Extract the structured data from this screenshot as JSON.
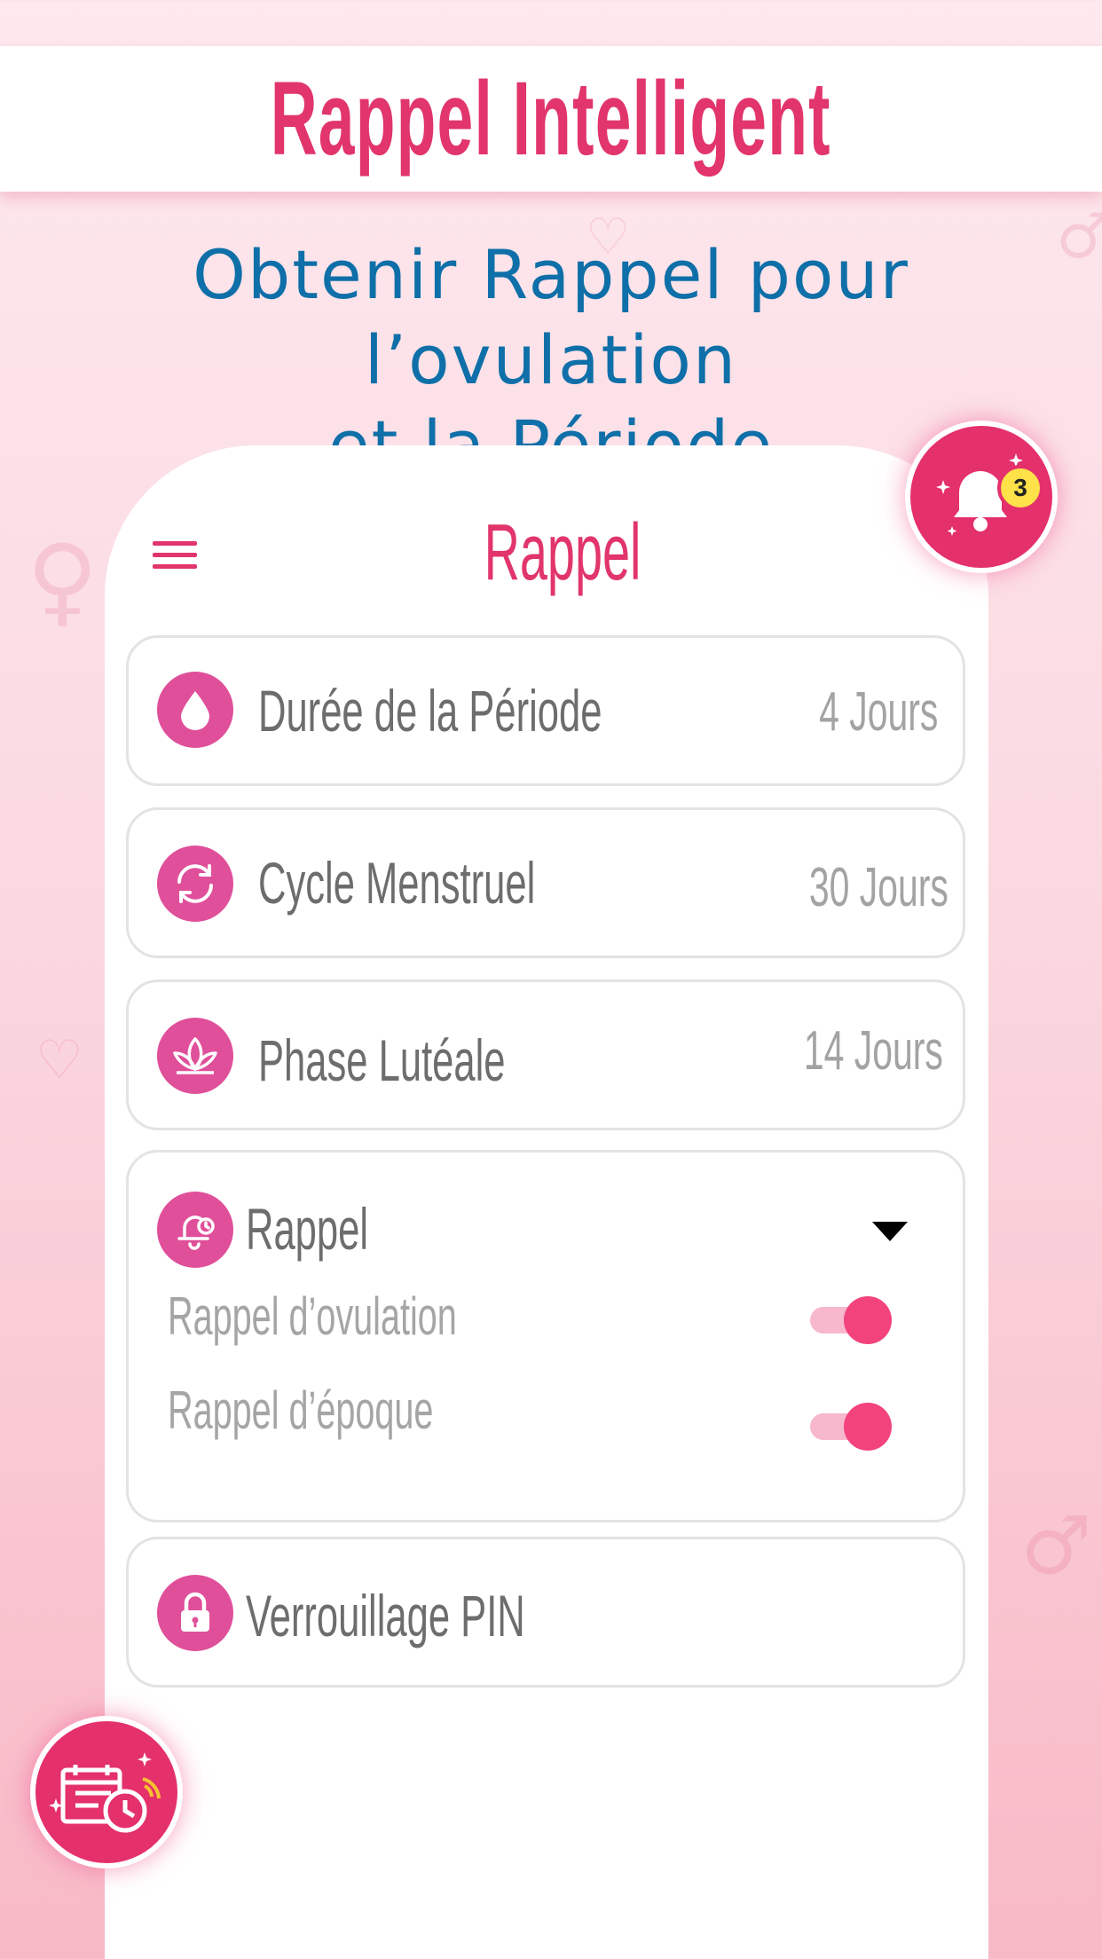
{
  "banner": {
    "title": "Rappel Intelligent"
  },
  "subtitle": {
    "line1": "Obtenir Rappel pour l’ovulation",
    "line2": "et la Période"
  },
  "screen": {
    "title": "Rappel"
  },
  "settings": {
    "period_duration": {
      "label": "Durée de la Période",
      "value": "4 Jours",
      "icon": "drop-icon"
    },
    "menstrual_cycle": {
      "label": "Cycle Menstruel",
      "value": "30 Jours",
      "icon": "refresh-icon"
    },
    "luteal_phase": {
      "label": "Phase Lutéale",
      "value": "14 Jours",
      "icon": "lotus-icon"
    },
    "reminder": {
      "label": "Rappel",
      "icon": "bell-icon",
      "options": [
        {
          "label": "Rappel d’ovulation",
          "enabled": true
        },
        {
          "label": "Rappel d’époque",
          "enabled": true
        }
      ]
    },
    "pin_lock": {
      "label": "Verrouillage PIN",
      "icon": "lock-icon"
    }
  },
  "notification_badge": {
    "count": "3"
  },
  "colors": {
    "accent": "#e1356b",
    "icon_bg": "#e04f9a",
    "subtitle": "#0f6fa8",
    "toggle_on": "#f2437c"
  }
}
